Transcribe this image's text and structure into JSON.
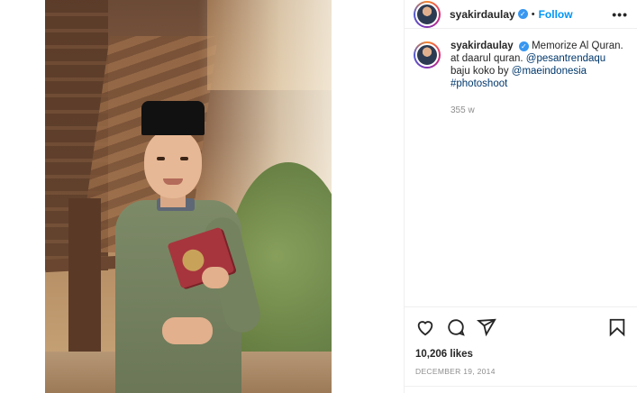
{
  "post": {
    "username": "syakirdaulay",
    "follow_label": "Follow",
    "more_label": "•••",
    "caption": {
      "username": "syakirdaulay",
      "text_1": "Memorize Al Quran. at daarul quran.",
      "mention_1": "@pesantrendaqu",
      "text_2": "baju koko by",
      "mention_2": "@maeindonesia",
      "hashtag": "#photoshoot",
      "time_ago": "355 w"
    },
    "likes": "10,206 likes",
    "date": "DECEMBER 19, 2014"
  },
  "icons": {
    "like": "heart-icon",
    "comment": "comment-icon",
    "share": "share-icon",
    "save": "bookmark-icon",
    "verified": "verified-badge-icon"
  },
  "colors": {
    "follow": "#0095f6",
    "verified": "#3897f0",
    "mention": "#00376b",
    "muted": "#8e8e8e"
  }
}
